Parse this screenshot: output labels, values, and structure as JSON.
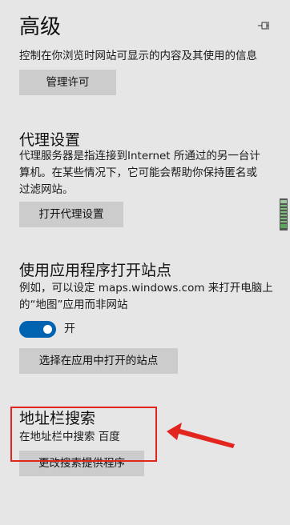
{
  "page": {
    "title": "高级"
  },
  "intro": {
    "description": "控制在你浏览时网站可显示的内容及其使用的信息",
    "manage_button": "管理许可"
  },
  "proxy": {
    "heading": "代理设置",
    "description_line1": "代理服务器是指连接到Internet 所通过的另一台计",
    "description_line2": "算机。在某些情况下，它可能会帮助你保持匿名或",
    "description_line3": "过滤网站。",
    "open_button": "打开代理设置"
  },
  "app_sites": {
    "heading": "使用应用程序打开站点",
    "description_line1": "例如，可以设定 maps.windows.com 来打开电脑上",
    "description_line2": "的“地图”应用而非网站",
    "toggle_label": "开",
    "choose_button": "选择在应用中打开的站点"
  },
  "address_bar": {
    "heading": "地址栏搜索",
    "description": "在地址栏中搜索 百度",
    "change_button": "更改搜索提供程序"
  },
  "colors": {
    "background": "#e6e6e6",
    "button": "#cccccc",
    "toggle_on": "#0063b1",
    "annotation_red": "#e2261f"
  },
  "icons": {
    "pin": "pin-icon"
  }
}
